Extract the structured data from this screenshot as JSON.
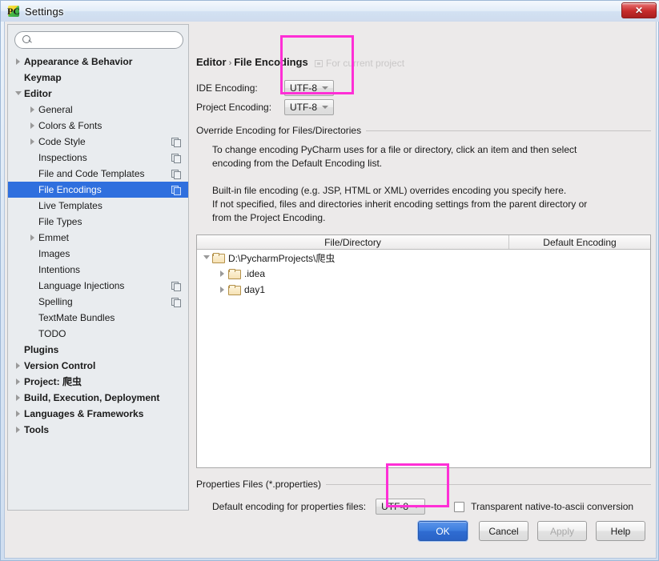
{
  "window": {
    "title": "Settings",
    "icon": "pycharm-icon",
    "close_label": "✕"
  },
  "sidebar": {
    "search": {
      "value": "",
      "placeholder": ""
    },
    "items": [
      {
        "label": "Appearance & Behavior",
        "indent": 0,
        "arrow": "closed",
        "bold": true,
        "copy": false,
        "selected": false
      },
      {
        "label": "Keymap",
        "indent": 0,
        "arrow": "none",
        "bold": true,
        "copy": false,
        "selected": false
      },
      {
        "label": "Editor",
        "indent": 0,
        "arrow": "open",
        "bold": true,
        "copy": false,
        "selected": false
      },
      {
        "label": "General",
        "indent": 1,
        "arrow": "closed",
        "bold": false,
        "copy": false,
        "selected": false
      },
      {
        "label": "Colors & Fonts",
        "indent": 1,
        "arrow": "closed",
        "bold": false,
        "copy": false,
        "selected": false
      },
      {
        "label": "Code Style",
        "indent": 1,
        "arrow": "closed",
        "bold": false,
        "copy": true,
        "selected": false
      },
      {
        "label": "Inspections",
        "indent": 1,
        "arrow": "none",
        "bold": false,
        "copy": true,
        "selected": false
      },
      {
        "label": "File and Code Templates",
        "indent": 1,
        "arrow": "none",
        "bold": false,
        "copy": true,
        "selected": false
      },
      {
        "label": "File Encodings",
        "indent": 1,
        "arrow": "none",
        "bold": false,
        "copy": true,
        "selected": true
      },
      {
        "label": "Live Templates",
        "indent": 1,
        "arrow": "none",
        "bold": false,
        "copy": false,
        "selected": false
      },
      {
        "label": "File Types",
        "indent": 1,
        "arrow": "none",
        "bold": false,
        "copy": false,
        "selected": false
      },
      {
        "label": "Emmet",
        "indent": 1,
        "arrow": "closed",
        "bold": false,
        "copy": false,
        "selected": false
      },
      {
        "label": "Images",
        "indent": 1,
        "arrow": "none",
        "bold": false,
        "copy": false,
        "selected": false
      },
      {
        "label": "Intentions",
        "indent": 1,
        "arrow": "none",
        "bold": false,
        "copy": false,
        "selected": false
      },
      {
        "label": "Language Injections",
        "indent": 1,
        "arrow": "none",
        "bold": false,
        "copy": true,
        "selected": false
      },
      {
        "label": "Spelling",
        "indent": 1,
        "arrow": "none",
        "bold": false,
        "copy": true,
        "selected": false
      },
      {
        "label": "TextMate Bundles",
        "indent": 1,
        "arrow": "none",
        "bold": false,
        "copy": false,
        "selected": false
      },
      {
        "label": "TODO",
        "indent": 1,
        "arrow": "none",
        "bold": false,
        "copy": false,
        "selected": false
      },
      {
        "label": "Plugins",
        "indent": 0,
        "arrow": "none",
        "bold": true,
        "copy": false,
        "selected": false
      },
      {
        "label": "Version Control",
        "indent": 0,
        "arrow": "closed",
        "bold": true,
        "copy": false,
        "selected": false
      },
      {
        "label": "Project: 爬虫",
        "indent": 0,
        "arrow": "closed",
        "bold": true,
        "copy": false,
        "selected": false
      },
      {
        "label": "Build, Execution, Deployment",
        "indent": 0,
        "arrow": "closed",
        "bold": true,
        "copy": false,
        "selected": false
      },
      {
        "label": "Languages & Frameworks",
        "indent": 0,
        "arrow": "closed",
        "bold": true,
        "copy": false,
        "selected": false
      },
      {
        "label": "Tools",
        "indent": 0,
        "arrow": "closed",
        "bold": true,
        "copy": false,
        "selected": false
      }
    ]
  },
  "main": {
    "breadcrumb_root": "Editor",
    "breadcrumb_sep": "›",
    "breadcrumb_current": "File Encodings",
    "for_current_project": "For current project",
    "ide_encoding_label": "IDE Encoding:",
    "ide_encoding_value": "UTF-8",
    "project_encoding_label": "Project Encoding:",
    "project_encoding_value": "UTF-8",
    "override_section_title": "Override Encoding for Files/Directories",
    "description_line1": "To change encoding PyCharm uses for a file or directory, click an item and then select",
    "description_line2": "encoding from the Default Encoding list.",
    "description_line3": "Built-in file encoding (e.g. JSP, HTML or XML) overrides encoding you specify here.",
    "description_line4": "If not specified, files and directories inherit encoding settings from the parent directory or",
    "description_line5": "from the Project Encoding.",
    "table": {
      "columns": [
        "File/Directory",
        "Default Encoding"
      ],
      "rows": [
        {
          "name": "D:\\PycharmProjects\\爬虫",
          "indent": 0,
          "arrow": "open",
          "encoding": ""
        },
        {
          "name": ".idea",
          "indent": 1,
          "arrow": "closed",
          "encoding": ""
        },
        {
          "name": "day1",
          "indent": 1,
          "arrow": "closed",
          "encoding": ""
        }
      ]
    },
    "properties_section_title": "Properties Files (*.properties)",
    "properties_encoding_label": "Default encoding for properties files:",
    "properties_encoding_value": "UTF-8",
    "transparent_checkbox_label": "Transparent native-to-ascii conversion",
    "transparent_checked": false
  },
  "footer": {
    "ok": "OK",
    "cancel": "Cancel",
    "apply": "Apply",
    "help": "Help"
  },
  "annotations": {
    "accent_color": "#ff2fd6",
    "box_top": "encoding-combos-highlight",
    "box_bottom": "properties-encoding-highlight"
  }
}
